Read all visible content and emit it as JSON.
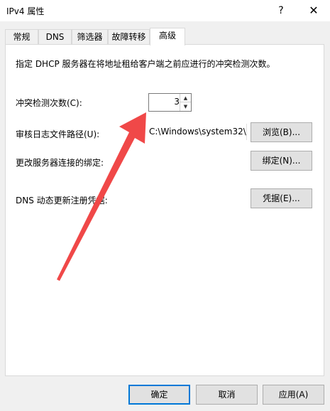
{
  "window": {
    "title": "IPv4 属性",
    "help_button": "?",
    "close_button": "✕"
  },
  "tabs": [
    {
      "label": "常规"
    },
    {
      "label": "DNS"
    },
    {
      "label": "筛选器"
    },
    {
      "label": "故障转移"
    },
    {
      "label": "高级"
    }
  ],
  "active_tab": "高级",
  "advanced": {
    "description": "指定 DHCP 服务器在将地址租给客户端之前应进行的冲突检测次数。",
    "conflict_label": "冲突检测次数(C):",
    "conflict_value": "3",
    "audit_label": "审核日志文件路径(U):",
    "audit_path": "C:\\Windows\\system32\\",
    "browse_button": "浏览(B)...",
    "bindings_label": "更改服务器连接的绑定:",
    "bindings_button": "绑定(N)...",
    "dns_label": "DNS 动态更新注册凭据:",
    "credentials_button": "凭据(E)..."
  },
  "footer": {
    "ok": "确定",
    "cancel": "取消",
    "apply": "应用(A)"
  },
  "colors": {
    "annotation_arrow": "#f04848",
    "primary_border": "#0078d7"
  }
}
